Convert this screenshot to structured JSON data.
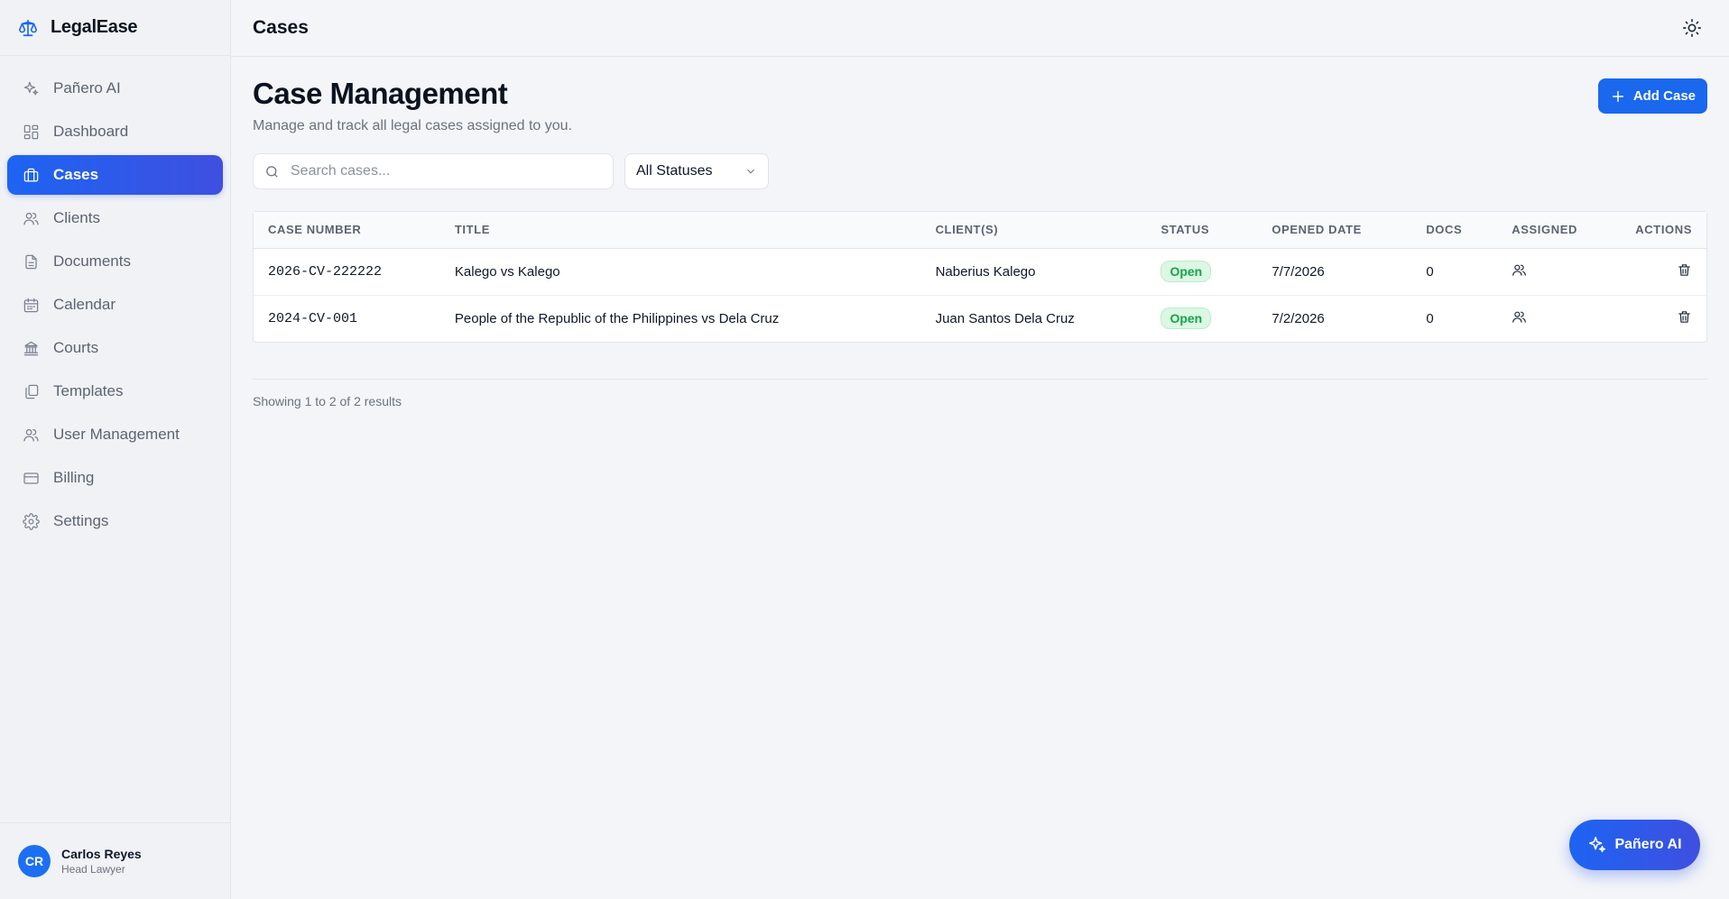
{
  "app": {
    "name": "LegalEase",
    "logo_icon": "scales-icon"
  },
  "header": {
    "title": "Cases",
    "theme_icon": "sun-icon"
  },
  "sidebar": {
    "items": [
      {
        "label": "Pañero AI",
        "icon": "sparkles-icon"
      },
      {
        "label": "Dashboard",
        "icon": "grid-icon"
      },
      {
        "label": "Cases",
        "icon": "briefcase-icon",
        "active": true
      },
      {
        "label": "Clients",
        "icon": "users-icon"
      },
      {
        "label": "Documents",
        "icon": "file-icon"
      },
      {
        "label": "Calendar",
        "icon": "calendar-icon"
      },
      {
        "label": "Courts",
        "icon": "landmark-icon"
      },
      {
        "label": "Templates",
        "icon": "copy-icon"
      },
      {
        "label": "User Management",
        "icon": "users-icon"
      },
      {
        "label": "Billing",
        "icon": "credit-card-icon"
      },
      {
        "label": "Settings",
        "icon": "gear-icon"
      }
    ]
  },
  "user": {
    "initials": "CR",
    "name": "Carlos Reyes",
    "role": "Head Lawyer"
  },
  "main": {
    "title": "Case Management",
    "subtitle": "Manage and track all legal cases assigned to you.",
    "add_label": "Add Case",
    "search_placeholder": "Search cases...",
    "status_filter": "All Statuses",
    "columns": [
      "Case Number",
      "Title",
      "Client(s)",
      "Status",
      "Opened Date",
      "Docs",
      "Assigned",
      "Actions"
    ],
    "rows": [
      {
        "case_number": "2026-CV-222222",
        "title": "Kalego vs Kalego",
        "clients": "Naberius Kalego",
        "status": "Open",
        "opened": "7/7/2026",
        "docs": "0"
      },
      {
        "case_number": "2024-CV-001",
        "title": "People of the Republic of the Philippines vs Dela Cruz",
        "clients": "Juan Santos Dela Cruz",
        "status": "Open",
        "opened": "7/2/2026",
        "docs": "0"
      }
    ],
    "results_text": "Showing 1 to 2 of 2 results"
  },
  "fab": {
    "label": "Pañero AI",
    "icon": "sparkles-icon"
  },
  "colors": {
    "accent": "#1a68ee",
    "accent_end": "#3f4fe0",
    "status_open_bg": "#dcf7e3",
    "status_open_text": "#16a34a"
  }
}
